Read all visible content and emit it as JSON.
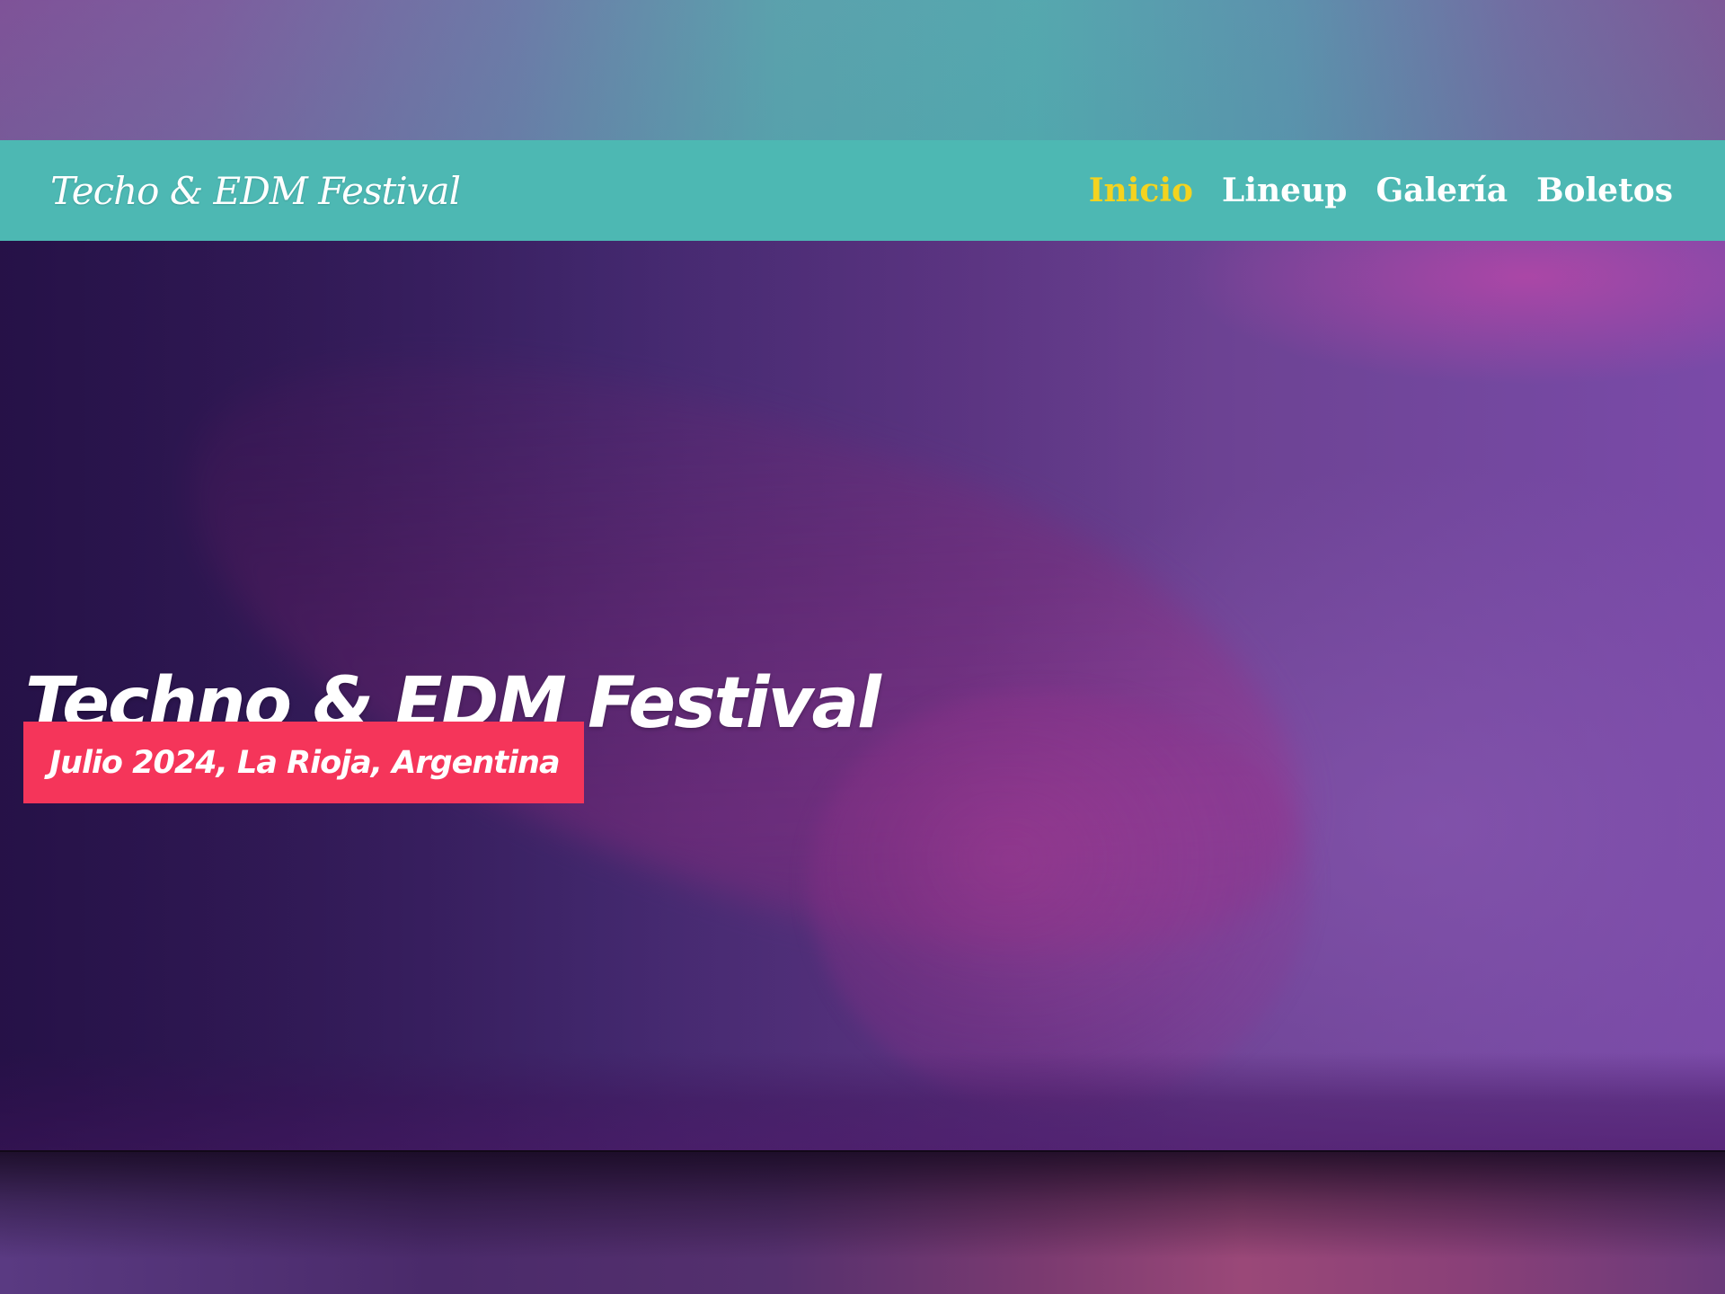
{
  "brand": {
    "name": "Techo & EDM Festival"
  },
  "nav": {
    "items": [
      {
        "label": "Inicio",
        "active": true
      },
      {
        "label": "Lineup",
        "active": false
      },
      {
        "label": "Galería",
        "active": false
      },
      {
        "label": "Boletos",
        "active": false
      }
    ]
  },
  "hero": {
    "title": "Techno & EDM Festival",
    "date_location": "Julio 2024, La Rioja, Argentina"
  },
  "colors": {
    "navbar": "#4db8b3",
    "nav_active": "#f4d31f",
    "badge": "#f5355a",
    "hero_overlay": "#5f3786"
  }
}
